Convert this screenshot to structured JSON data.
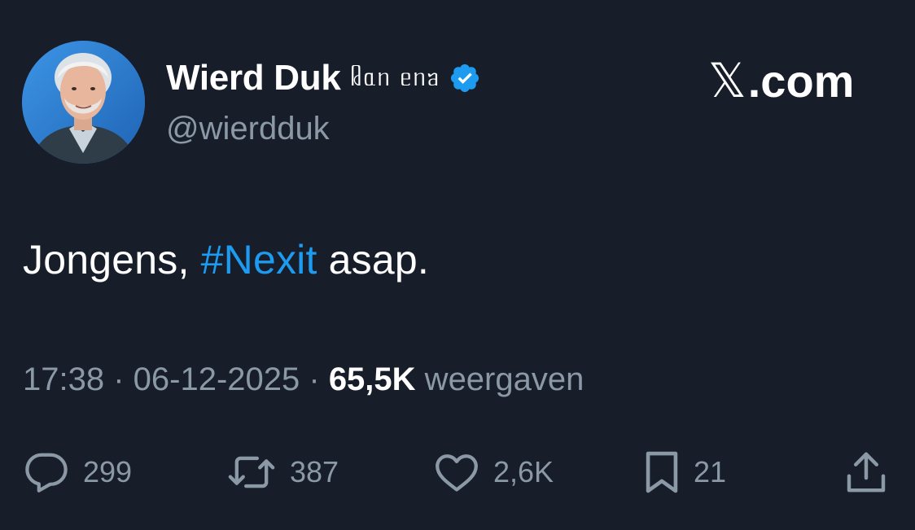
{
  "author": {
    "display_name": "Wierd Duk",
    "name_suffix": "ᥤᥲᥒ ᥱᥒᥑ",
    "handle": "@wierdduk",
    "verified": true,
    "avatar_icon": "profile-photo"
  },
  "brand": {
    "x_letter": "𝕏",
    "site_suffix": ".com"
  },
  "tweet": {
    "text_before": "Jongens, ",
    "hashtag": "#Nexit",
    "text_after": " asap."
  },
  "meta": {
    "time": "17:38",
    "separator": " · ",
    "date": "06-12-2025",
    "views_count": "65,5K",
    "views_label": " weergaven"
  },
  "actions": {
    "replies": "299",
    "reposts": "387",
    "likes": "2,6K",
    "bookmarks": "21"
  },
  "colors": {
    "background": "#171d29",
    "accent": "#1d9bf0",
    "muted": "#8b98a5",
    "text": "#ffffff"
  }
}
